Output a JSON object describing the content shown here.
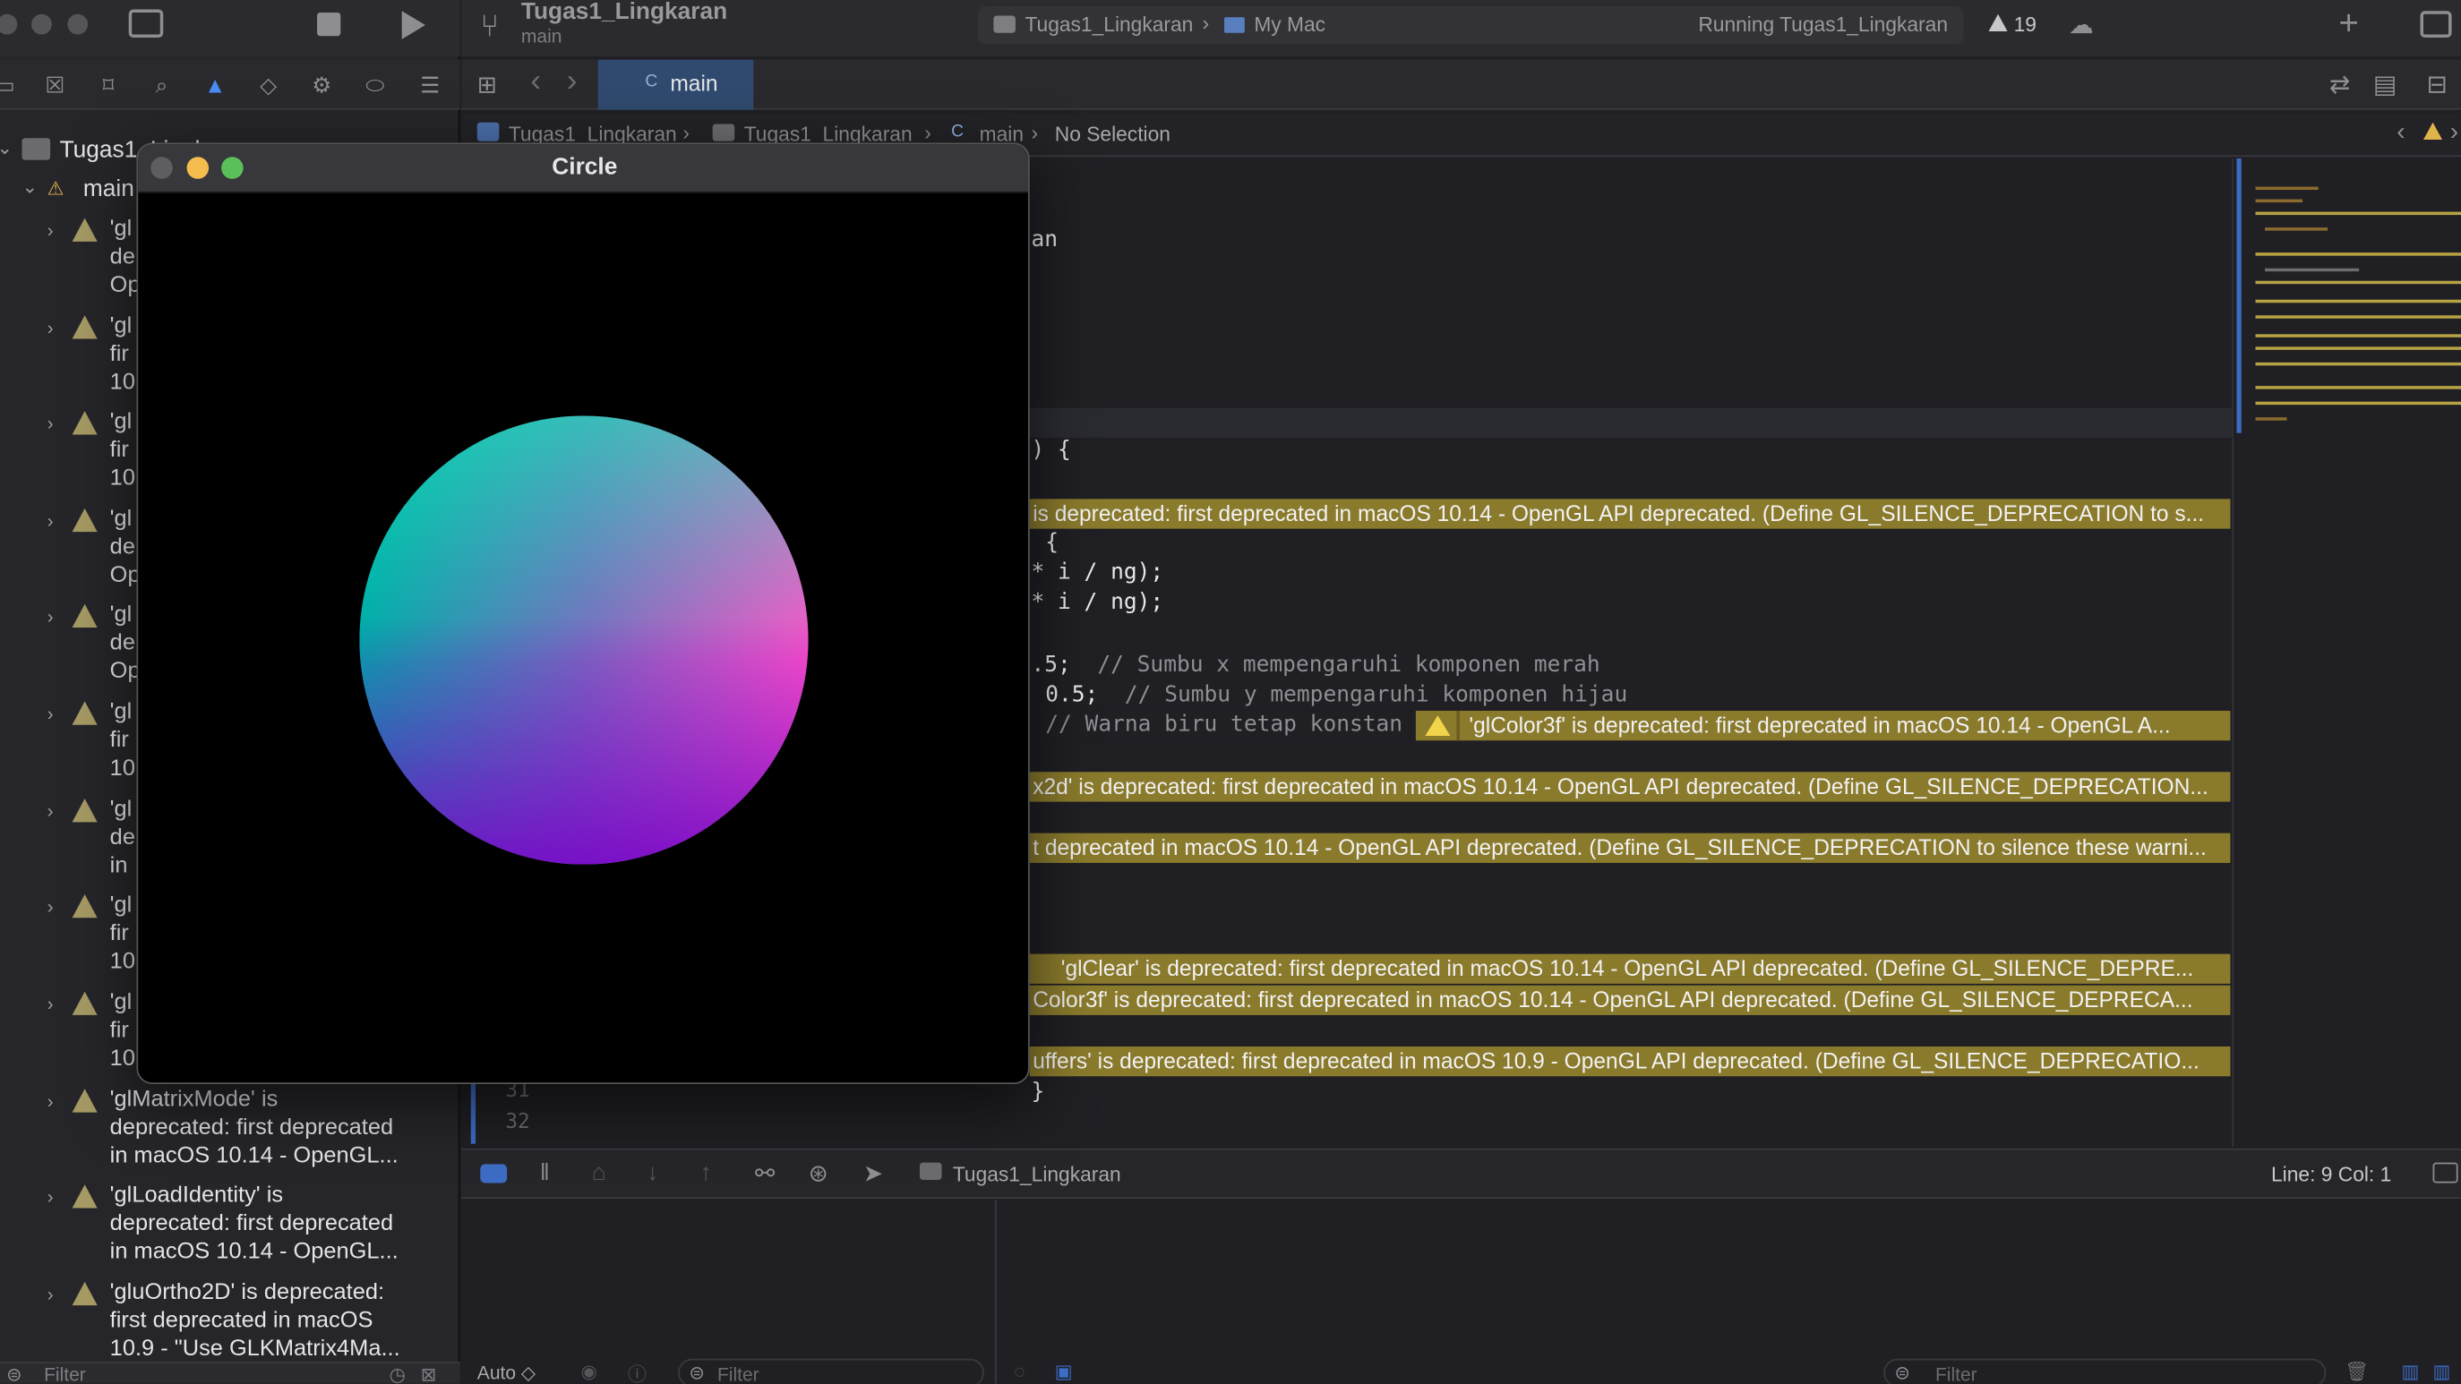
{
  "toolbar": {
    "project_title": "Tugas1_Lingkaran",
    "branch": "main",
    "scheme": "Tugas1_Lingkaran",
    "destination": "My Mac",
    "status": "Running Tugas1_Lingkaran",
    "warning_count": "19"
  },
  "tabs": [
    {
      "label": "main"
    }
  ],
  "breadcrumb": {
    "project": "Tugas1_Lingkaran",
    "folder": "Tugas1_Lingkaran",
    "file": "main",
    "selection": "No Selection"
  },
  "navigator": {
    "project": "Tugas1_Lingkaran",
    "file": "main",
    "issues": [
      {
        "text": "'gl\nde\nOp"
      },
      {
        "text": "'gl\nfir\n10"
      },
      {
        "text": "'gl\nfir\n10"
      },
      {
        "text": "'gl\nde\nOp"
      },
      {
        "text": "'gl\nde\nOp"
      },
      {
        "text": "'gl\nfir\n10"
      },
      {
        "text": "'gl\nde\nin"
      },
      {
        "text": "'gl\nfir\n10"
      },
      {
        "text": "'gl\nfir\n10"
      },
      {
        "text": "'glMatrixMode' is\ndeprecated: first deprecated\nin macOS 10.14 - OpenGL..."
      },
      {
        "text": "'glLoadIdentity' is\ndeprecated: first deprecated\nin macOS 10.14 - OpenGL..."
      },
      {
        "text": "'gluOrtho2D' is deprecated:\nfirst deprecated in macOS\n10.9 - \"Use GLKMatrix4Ma..."
      }
    ],
    "filter_placeholder": "Filter"
  },
  "editor": {
    "code_lines": [
      {
        "text": "an"
      },
      {
        "text": ") {"
      },
      {
        "text": "{"
      },
      {
        "text": "* i / ng);"
      },
      {
        "text": "* i / ng);"
      },
      {
        "code": ".5;",
        "comment": "// Sumbu x mempengaruhi komponen merah"
      },
      {
        "code": "0.5;",
        "comment": "// Sumbu y mempengaruhi komponen hijau"
      },
      {
        "code": "",
        "comment": "// Warna biru tetap konstan"
      },
      {
        "text": "}"
      }
    ],
    "line_numbers": [
      "31",
      "32"
    ],
    "warnings": [
      "is deprecated: first deprecated in macOS 10.14 - OpenGL API deprecated. (Define GL_SILENCE_DEPRECATION to s...",
      "'glColor3f' is deprecated: first deprecated in macOS 10.14 - OpenGL A...",
      "x2d' is deprecated: first deprecated in macOS 10.14 - OpenGL API deprecated. (Define GL_SILENCE_DEPRECATION...",
      "t deprecated in macOS 10.14 - OpenGL API deprecated. (Define GL_SILENCE_DEPRECATION to silence these warni...",
      "'glClear' is deprecated: first deprecated in macOS 10.14 - OpenGL API deprecated. (Define GL_SILENCE_DEPRE...",
      "Color3f' is deprecated: first deprecated in macOS 10.14 - OpenGL API deprecated. (Define GL_SILENCE_DEPRECA...",
      "uffers' is deprecated: first deprecated in macOS 10.9 - OpenGL API deprecated. (Define GL_SILENCE_DEPRECATIO..."
    ]
  },
  "debug": {
    "target": "Tugas1_Lingkaran",
    "position": "Line: 9  Col: 1",
    "auto_label": "Auto ◇",
    "filter_left": "Filter",
    "filter_right": "Filter"
  },
  "window": {
    "title": "Circle"
  },
  "colors": {
    "warning_bar": "#8a7a2c",
    "accent_tab": "#2f4a6e"
  }
}
